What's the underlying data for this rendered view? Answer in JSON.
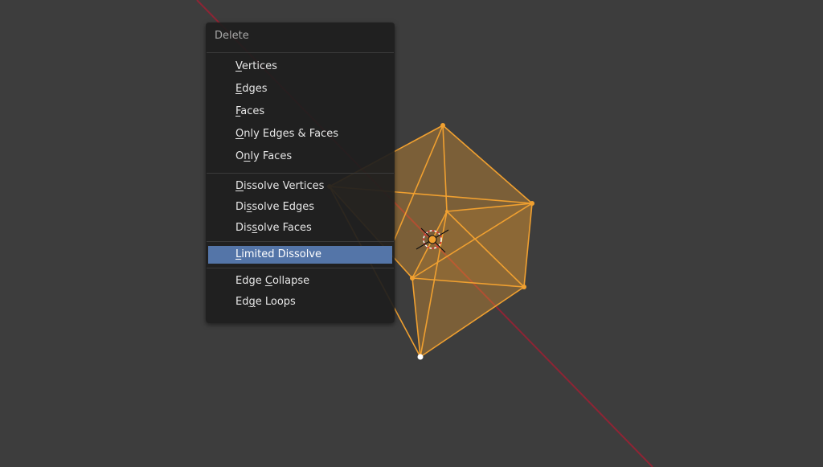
{
  "viewport": {
    "background": "#3d3d3d",
    "axis_color": "#8f2434",
    "mesh_color": "#f0a030"
  },
  "menu": {
    "title": "Delete",
    "groups": [
      [
        {
          "label": "Vertices",
          "mnemonic": 0
        },
        {
          "label": "Edges",
          "mnemonic": 0
        },
        {
          "label": "Faces",
          "mnemonic": 0
        },
        {
          "label": "Only Edges & Faces",
          "mnemonic": 0
        },
        {
          "label": "Only Faces",
          "mnemonic": 1
        }
      ],
      [
        {
          "label": "Dissolve Vertices",
          "mnemonic": 0
        },
        {
          "label": "Dissolve Edges",
          "mnemonic": 2
        },
        {
          "label": "Dissolve Faces",
          "mnemonic": 3
        }
      ],
      [
        {
          "label": "Limited Dissolve",
          "mnemonic": 0,
          "active": true
        }
      ],
      [
        {
          "label": "Edge Collapse",
          "mnemonic": 5
        },
        {
          "label": "Edge Loops",
          "mnemonic": 2
        }
      ]
    ],
    "highlight_color": "#5475a8"
  }
}
